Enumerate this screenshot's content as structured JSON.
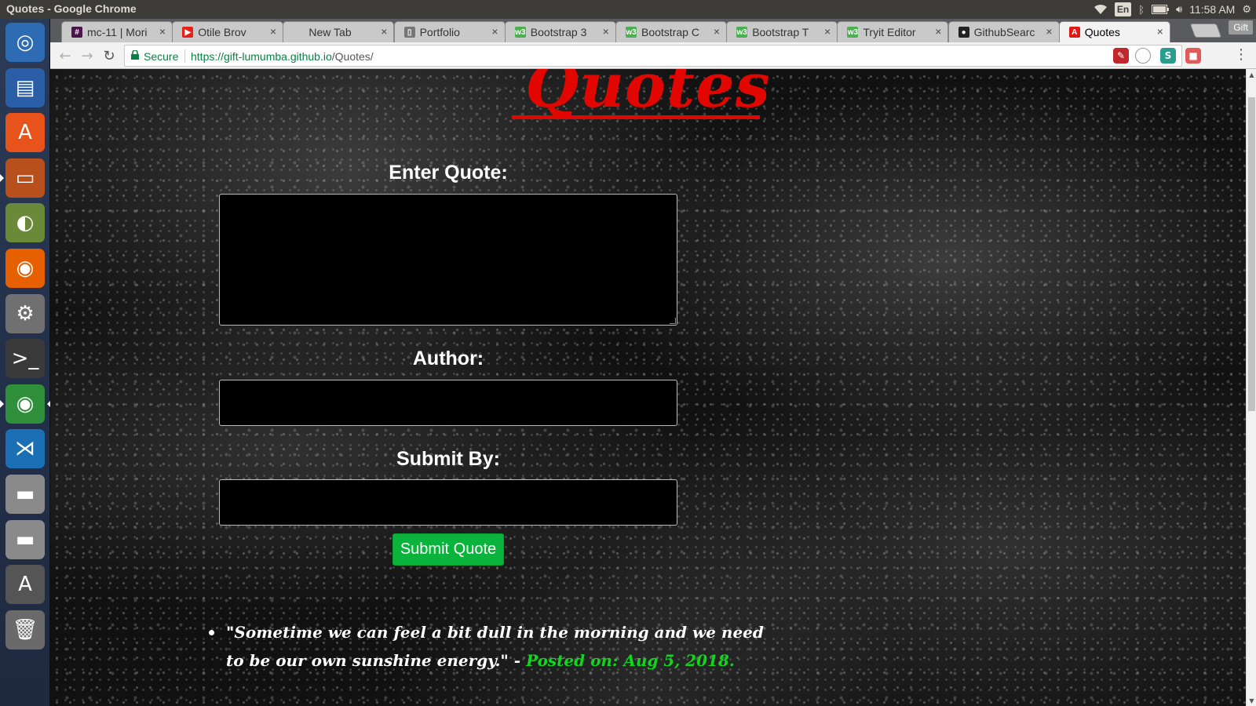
{
  "window": {
    "title": "Quotes - Google Chrome"
  },
  "tray": {
    "lang": "En",
    "clock": "11:58 AM"
  },
  "launcher": {
    "items": [
      {
        "name": "ubuntu-dash-icon",
        "glyph": "◎",
        "color": "#2d6bb3"
      },
      {
        "name": "writer-icon",
        "glyph": "▤",
        "color": "#2a5fa8"
      },
      {
        "name": "software-center-icon",
        "glyph": "A",
        "color": "#e8531b"
      },
      {
        "name": "files-icon",
        "glyph": "▭",
        "color": "#b8501e"
      },
      {
        "name": "disk-usage-icon",
        "glyph": "◐",
        "color": "#6a8a3a"
      },
      {
        "name": "firefox-icon",
        "glyph": "◉",
        "color": "#e66000"
      },
      {
        "name": "system-settings-icon",
        "glyph": "⚙",
        "color": "#707070"
      },
      {
        "name": "terminal-icon",
        "glyph": ">_",
        "color": "#3a3a3a"
      },
      {
        "name": "chrome-icon",
        "glyph": "◉",
        "color": "#2f8f3a"
      },
      {
        "name": "vscode-icon",
        "glyph": "⋊",
        "color": "#1b6fb5"
      },
      {
        "name": "drive-icon-1",
        "glyph": "▬",
        "color": "#8a8a8a"
      },
      {
        "name": "drive-icon-2",
        "glyph": "▬",
        "color": "#8a8a8a"
      },
      {
        "name": "software-updater-icon",
        "glyph": "A",
        "color": "#555"
      },
      {
        "name": "trash-icon",
        "glyph": "🗑",
        "color": "#6a6a6a"
      }
    ]
  },
  "tabs": [
    {
      "label": "mc-11 | Mori",
      "fav": "#",
      "fav_bg": "#4a154b"
    },
    {
      "label": "Otile Brov",
      "fav": "▶",
      "fav_bg": "#e62117"
    },
    {
      "label": "New Tab",
      "fav": "",
      "fav_bg": "transparent"
    },
    {
      "label": "Portfolio",
      "fav": "▯",
      "fav_bg": "#777"
    },
    {
      "label": "Bootstrap 3",
      "fav": "w3",
      "fav_bg": "#4caf50"
    },
    {
      "label": "Bootstrap C",
      "fav": "w3",
      "fav_bg": "#4caf50"
    },
    {
      "label": "Bootstrap T",
      "fav": "w3",
      "fav_bg": "#4caf50"
    },
    {
      "label": "Tryit Editor",
      "fav": "w3",
      "fav_bg": "#4caf50"
    },
    {
      "label": "GithubSearc",
      "fav": "●",
      "fav_bg": "#222"
    },
    {
      "label": "Quotes",
      "fav": "A",
      "fav_bg": "#dd1b16"
    }
  ],
  "profile": "Gift",
  "toolbar": {
    "secure": "Secure",
    "url_host": "https://gift-lumumba.github.io",
    "url_path": "/Quotes/"
  },
  "page": {
    "heading": "Quotes",
    "quote_label": "Enter Quote:",
    "author_label": "Author:",
    "submit_by_label": "Submit By:",
    "submit_button": "Submit Quote",
    "quote_value": "",
    "author_value": "",
    "submit_by_value": "",
    "quotes": [
      {
        "text": "\"Sometime we can feel a bit dull in the morning and we need to be our own sunshine energy.\" -",
        "posted": "Posted on: Aug 5, 2018."
      }
    ]
  },
  "colors": {
    "heading": "#e10600",
    "submit": "#0ab43c",
    "posted": "#12d61e"
  }
}
